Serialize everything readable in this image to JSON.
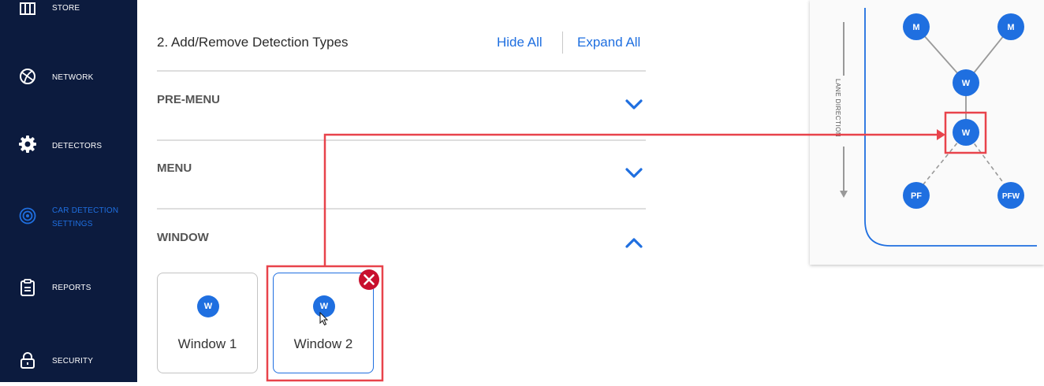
{
  "sidebar": {
    "items": [
      {
        "label": "STORE",
        "icon": "store-icon"
      },
      {
        "label": "NETWORK",
        "icon": "network-globe-icon"
      },
      {
        "label": "DETECTORS",
        "icon": "gear-icon"
      },
      {
        "label_line1": "CAR DETECTION",
        "label_line2": "SETTINGS",
        "icon": "radar-icon",
        "active": true
      },
      {
        "label": "REPORTS",
        "icon": "clipboard-icon"
      },
      {
        "label": "SECURITY",
        "icon": "lock-icon"
      }
    ]
  },
  "section": {
    "title": "2. Add/Remove Detection Types",
    "hide_all": "Hide All",
    "expand_all": "Expand All"
  },
  "accordions": [
    {
      "label": "PRE-MENU",
      "state": "collapsed"
    },
    {
      "label": "MENU",
      "state": "collapsed"
    },
    {
      "label": "WINDOW",
      "state": "expanded"
    }
  ],
  "window_cards": [
    {
      "badge": "W",
      "label": "Window 1",
      "selected": false
    },
    {
      "badge": "W",
      "label": "Window 2",
      "selected": true
    }
  ],
  "diagram": {
    "lane_direction_label": "LANE DIRECTION",
    "nodes": [
      {
        "id": "m1",
        "label": "M"
      },
      {
        "id": "m2",
        "label": "M"
      },
      {
        "id": "w1",
        "label": "W"
      },
      {
        "id": "w2",
        "label": "W"
      },
      {
        "id": "pf",
        "label": "PF"
      },
      {
        "id": "pfw",
        "label": "PFW"
      }
    ]
  },
  "colors": {
    "sidebar_bg": "#0c1b3e",
    "accent": "#1f6fe0",
    "highlight_red": "#e8434b",
    "remove_red": "#c8102e"
  }
}
